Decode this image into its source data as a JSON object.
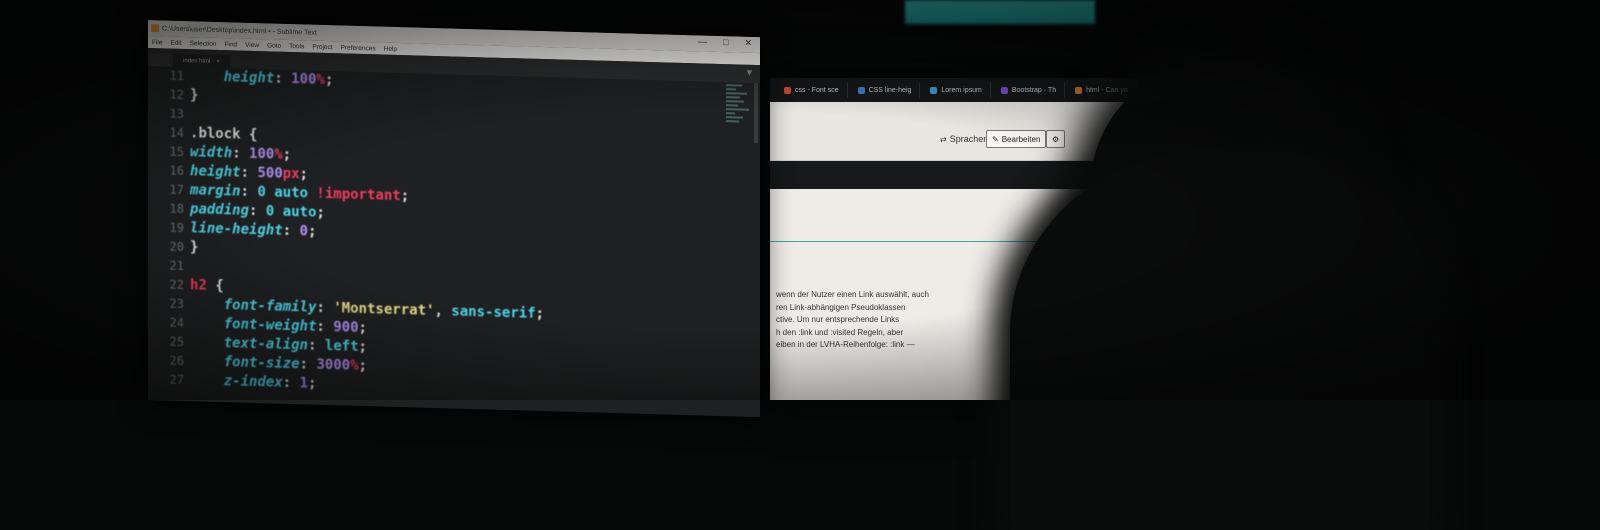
{
  "editor": {
    "title": "C:\\Users\\user\\Desktop\\index.html • - Sublime Text",
    "window_controls": [
      "—",
      "□",
      "✕"
    ],
    "menu": [
      "File",
      "Edit",
      "Selection",
      "Find",
      "View",
      "Goto",
      "Tools",
      "Project",
      "Preferences",
      "Help"
    ],
    "tabs": [
      "index.html"
    ],
    "line_numbers": [
      "11",
      "12",
      "13",
      "14",
      "15",
      "16",
      "17",
      "18",
      "19",
      "20",
      "21",
      "22",
      "23",
      "24",
      "25",
      "26",
      "27"
    ],
    "code_lines": [
      [
        {
          "t": "    ",
          "c": "pun"
        },
        {
          "t": "height",
          "c": "prop"
        },
        {
          "t": ": ",
          "c": "pun"
        },
        {
          "t": "100",
          "c": "num"
        },
        {
          "t": "%",
          "c": "unit"
        },
        {
          "t": ";",
          "c": "pun"
        }
      ],
      [
        {
          "t": "}",
          "c": "pun"
        }
      ],
      [
        {
          "t": "",
          "c": "pun"
        }
      ],
      [
        {
          "t": ".block",
          "c": "sel"
        },
        {
          "t": " {",
          "c": "pun"
        }
      ],
      [
        {
          "t": "width",
          "c": "prop"
        },
        {
          "t": ": ",
          "c": "pun"
        },
        {
          "t": "100",
          "c": "num"
        },
        {
          "t": "%",
          "c": "unit"
        },
        {
          "t": ";",
          "c": "pun"
        }
      ],
      [
        {
          "t": "height",
          "c": "prop"
        },
        {
          "t": ": ",
          "c": "pun"
        },
        {
          "t": "500",
          "c": "num"
        },
        {
          "t": "px",
          "c": "unit"
        },
        {
          "t": ";",
          "c": "pun"
        }
      ],
      [
        {
          "t": "margin",
          "c": "prop"
        },
        {
          "t": ": ",
          "c": "pun"
        },
        {
          "t": "0 auto ",
          "c": "val"
        },
        {
          "t": "!important",
          "c": "kw"
        },
        {
          "t": ";",
          "c": "pun"
        }
      ],
      [
        {
          "t": "padding",
          "c": "prop"
        },
        {
          "t": ": ",
          "c": "pun"
        },
        {
          "t": "0 auto",
          "c": "val"
        },
        {
          "t": ";",
          "c": "pun"
        }
      ],
      [
        {
          "t": "line-height",
          "c": "prop"
        },
        {
          "t": ": ",
          "c": "pun"
        },
        {
          "t": "0",
          "c": "num"
        },
        {
          "t": ";",
          "c": "pun"
        }
      ],
      [
        {
          "t": "}",
          "c": "pun"
        }
      ],
      [
        {
          "t": "",
          "c": "pun"
        }
      ],
      [
        {
          "t": "h2",
          "c": "tag"
        },
        {
          "t": " {",
          "c": "pun"
        }
      ],
      [
        {
          "t": "    ",
          "c": "pun"
        },
        {
          "t": "font-family",
          "c": "prop"
        },
        {
          "t": ": ",
          "c": "pun"
        },
        {
          "t": "'Montserrat'",
          "c": "str"
        },
        {
          "t": ", ",
          "c": "pun"
        },
        {
          "t": "sans-serif",
          "c": "val"
        },
        {
          "t": ";",
          "c": "pun"
        }
      ],
      [
        {
          "t": "    ",
          "c": "pun"
        },
        {
          "t": "font-weight",
          "c": "prop"
        },
        {
          "t": ": ",
          "c": "pun"
        },
        {
          "t": "900",
          "c": "num"
        },
        {
          "t": ";",
          "c": "pun"
        }
      ],
      [
        {
          "t": "    ",
          "c": "pun"
        },
        {
          "t": "text-align",
          "c": "prop"
        },
        {
          "t": ": ",
          "c": "pun"
        },
        {
          "t": "left",
          "c": "val"
        },
        {
          "t": ";",
          "c": "pun"
        }
      ],
      [
        {
          "t": "    ",
          "c": "pun"
        },
        {
          "t": "font-size",
          "c": "prop"
        },
        {
          "t": ": ",
          "c": "pun"
        },
        {
          "t": "3000",
          "c": "num"
        },
        {
          "t": "%",
          "c": "unit"
        },
        {
          "t": ";",
          "c": "pun"
        }
      ],
      [
        {
          "t": "    ",
          "c": "pun"
        },
        {
          "t": "z-index",
          "c": "prop"
        },
        {
          "t": ": ",
          "c": "pun"
        },
        {
          "t": "1",
          "c": "num"
        },
        {
          "t": ";",
          "c": "pun"
        }
      ]
    ]
  },
  "browser": {
    "tabs": [
      {
        "label": "css - Font sce",
        "color": "#d04a3a"
      },
      {
        "label": "CSS line-heig",
        "color": "#3a7bd0"
      },
      {
        "label": "Lorem ipsum",
        "color": "#3a9bd0"
      },
      {
        "label": "Bootstrap · Th",
        "color": "#7b4ad0"
      },
      {
        "label": "html - Can yo",
        "color": "#d07a3a"
      }
    ],
    "languages_label": "Sprachen",
    "edit_label": "Bearbeiten",
    "settings_icon": "gear-icon",
    "text_lines": [
      "wenn der Nutzer einen Link auswählt, auch",
      "ren Link-abhängigen Pseudoklassen",
      "ctive. Um nur entsprechende Links",
      "h den :link und :visited Regeln, aber",
      "eiben in der LVHA-Reihenfolge: :link —"
    ]
  },
  "colors": {
    "editor_bg": "#1f2021",
    "property": "#4fd6ea",
    "unit": "#f23d61",
    "number": "#b493f8",
    "string": "#eadd8c"
  }
}
